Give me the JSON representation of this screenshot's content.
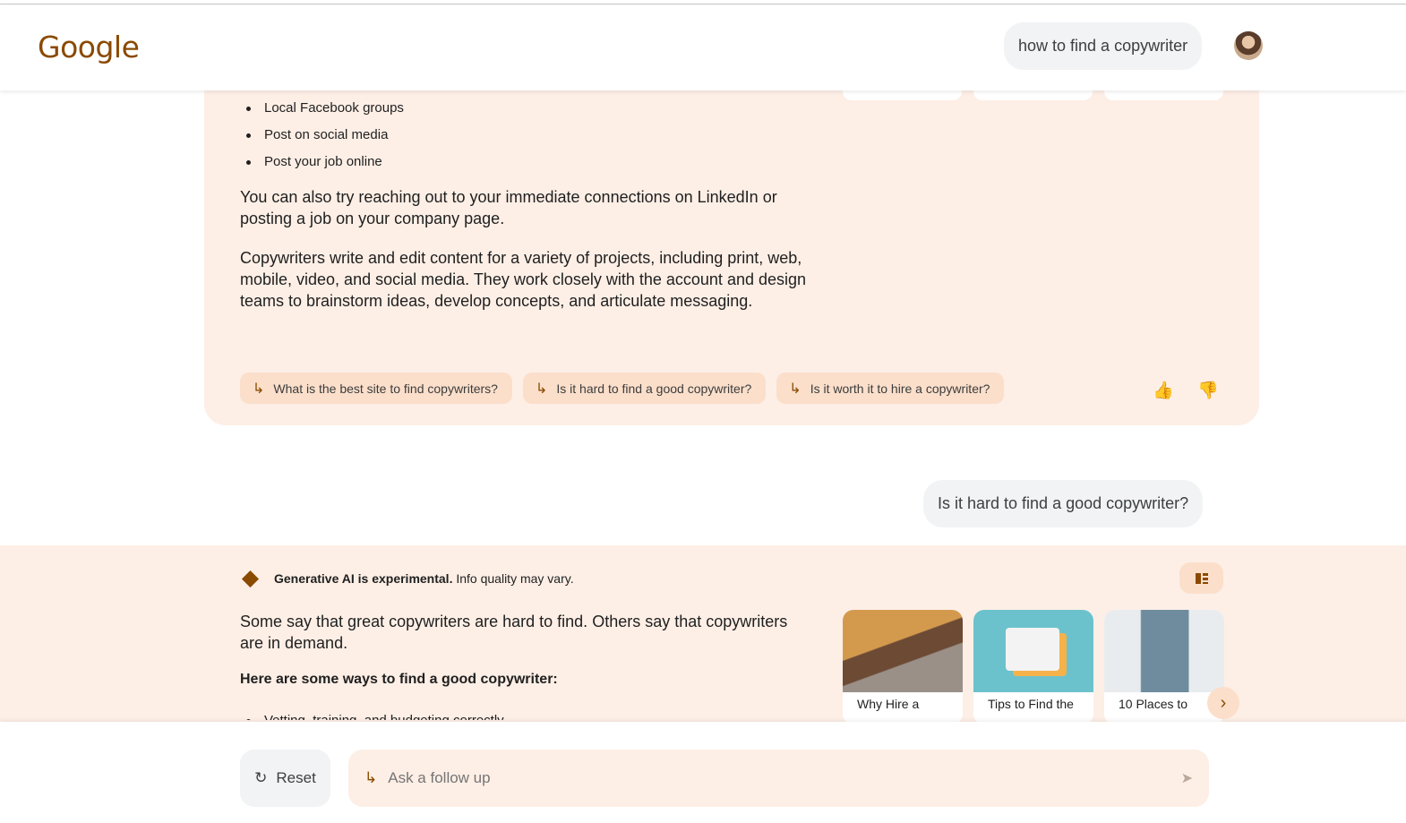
{
  "header": {
    "logo": "Google",
    "search_query": "how to find a copywriter"
  },
  "answer1": {
    "bullets": [
      "Local Facebook groups",
      "Post on social media",
      "Post your job online"
    ],
    "para1": "You can also try reaching out to your immediate connections on LinkedIn or posting a job on your company page.",
    "para2": "Copywriters write and edit content for a variety of projects, including print, web, mobile, video, and social media. They work closely with the account and design teams to brainstorm ideas, develop concepts, and articulate messaging.",
    "chips": [
      "What is the best site to find copywriters?",
      "Is it hard to find a good copywriter?",
      "Is it worth it to hire a copywriter?"
    ]
  },
  "user_question": "Is it hard to find a good copywriter?",
  "answer2": {
    "label_bold": "Generative AI is experimental.",
    "label_rest": "Info quality may vary.",
    "para1": "Some say that great copywriters are hard to find. Others say that copywriters are in demand.",
    "heading": "Here are some ways to find a good copywriter:",
    "bullet1": "Vetting, training, and budgeting correctly",
    "sources": [
      {
        "caption": "Why Hire a"
      },
      {
        "caption": "Tips to Find the"
      },
      {
        "caption": "10 Places to"
      }
    ]
  },
  "bottom": {
    "reset_label": "Reset",
    "ask_placeholder": "Ask a follow up"
  },
  "colors": {
    "accent": "#8a4a00",
    "card_bg": "#fdefe6",
    "chip_bg": "#fbdfcb"
  }
}
